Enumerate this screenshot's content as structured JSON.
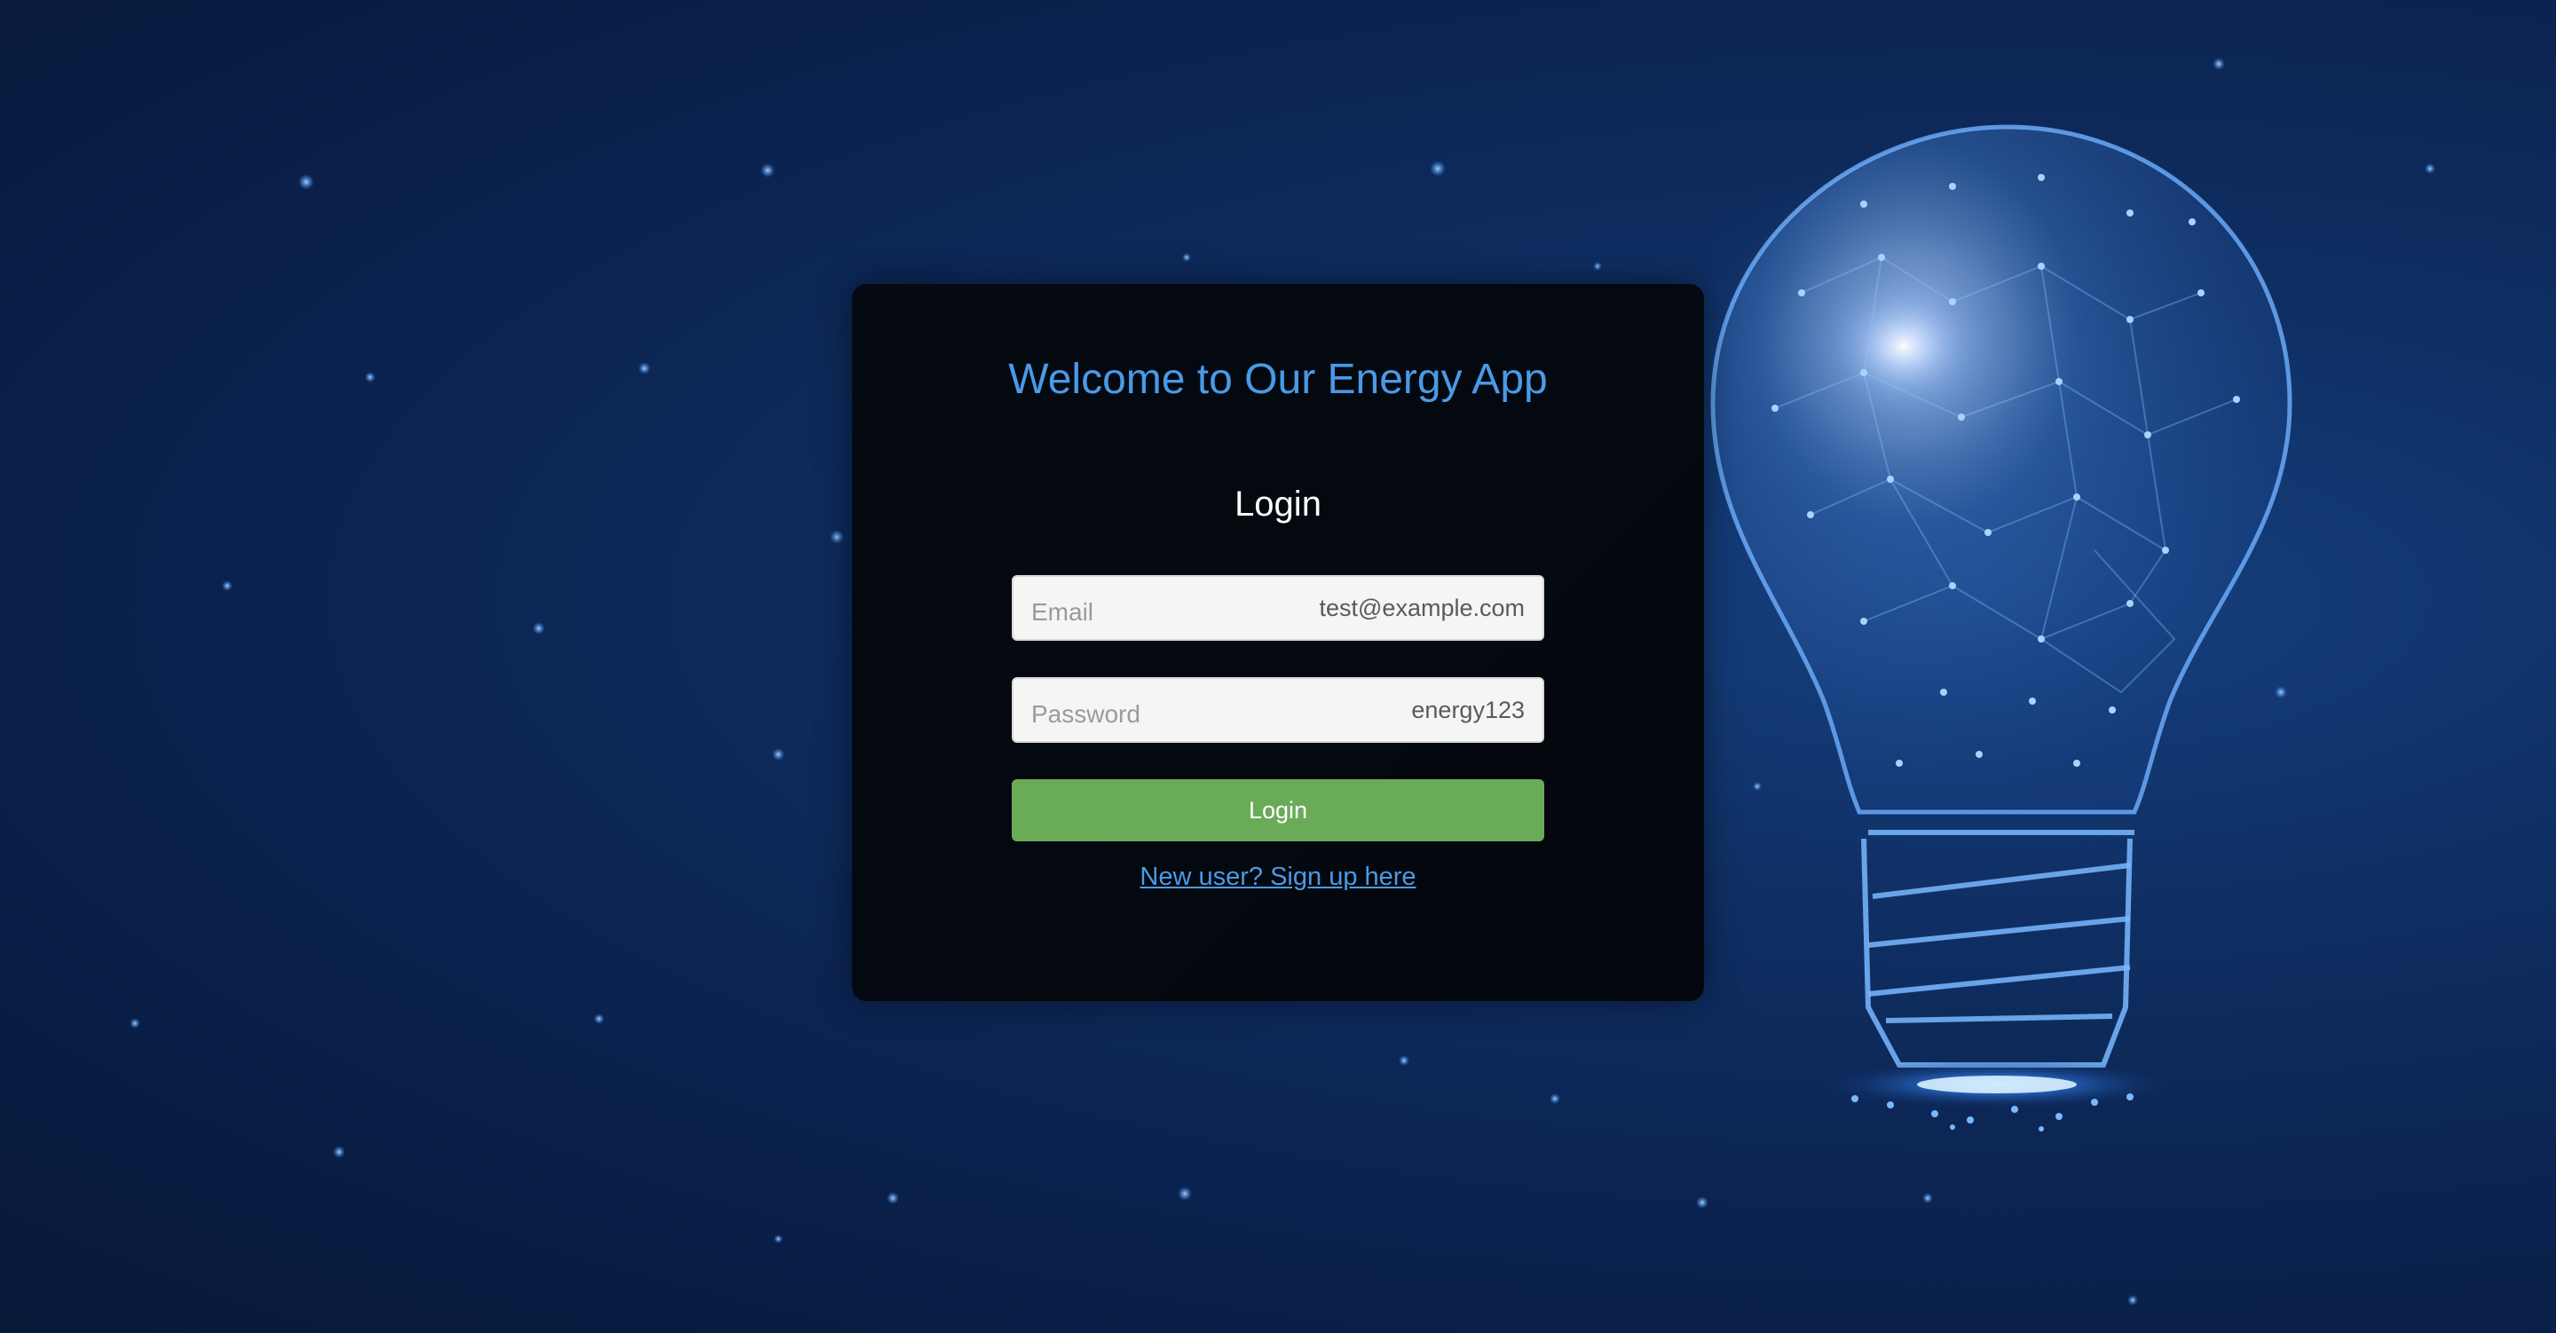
{
  "app_title": "Welcome to Our Energy App",
  "login_form": {
    "heading": "Login",
    "email_field": {
      "placeholder": "Email",
      "value": "test@example.com"
    },
    "password_field": {
      "placeholder": "Password",
      "value": "energy123"
    },
    "login_button_label": "Login",
    "signup_link_text": "New user? Sign up here"
  },
  "colors": {
    "accent": "#4a9ae6",
    "login_button": "#6aab58",
    "card_background": "#03070d",
    "page_background": "#0b2350"
  },
  "background_image": "glowing-lightbulb-network"
}
